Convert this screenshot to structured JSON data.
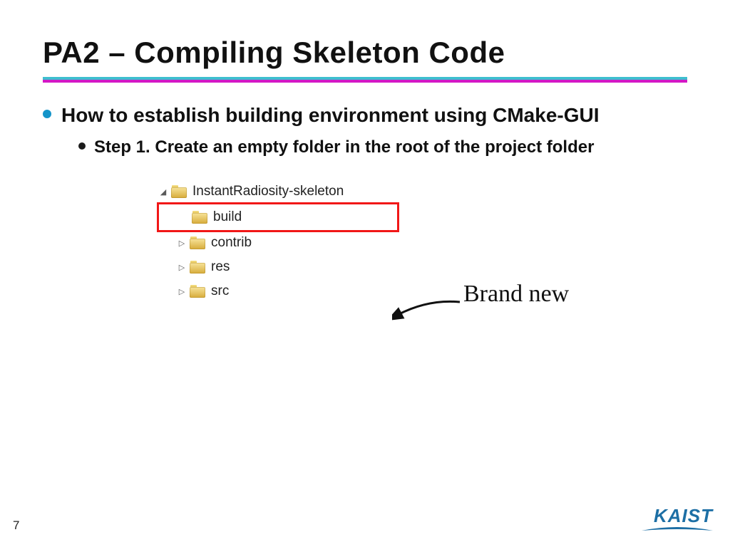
{
  "title": "PA2 – Compiling Skeleton Code",
  "bullet1": "How to establish building environment using CMake-GUI",
  "bullet2": "Step 1. Create an empty folder in the root of the project folder",
  "tree": {
    "root": "InstantRadiosity-skeleton",
    "children": [
      "build",
      "contrib",
      "res",
      "src"
    ],
    "highlighted": "build"
  },
  "annotation": "Brand new",
  "pageNumber": "7",
  "logoText": "KAIST"
}
